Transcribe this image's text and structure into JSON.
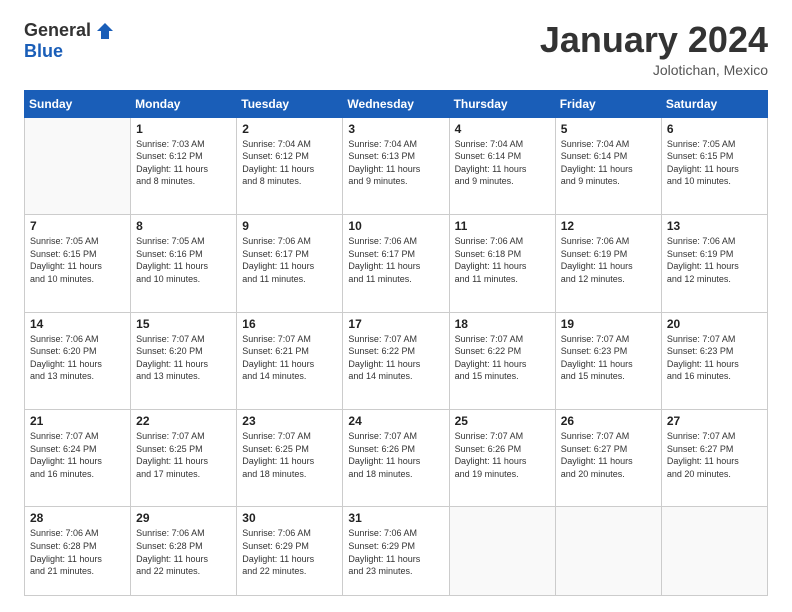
{
  "header": {
    "logo": {
      "general": "General",
      "blue": "Blue"
    },
    "title": "January 2024",
    "location": "Jolotichan, Mexico"
  },
  "calendar": {
    "days_of_week": [
      "Sunday",
      "Monday",
      "Tuesday",
      "Wednesday",
      "Thursday",
      "Friday",
      "Saturday"
    ],
    "weeks": [
      [
        {
          "day": "",
          "info": ""
        },
        {
          "day": "1",
          "info": "Sunrise: 7:03 AM\nSunset: 6:12 PM\nDaylight: 11 hours\nand 8 minutes."
        },
        {
          "day": "2",
          "info": "Sunrise: 7:04 AM\nSunset: 6:12 PM\nDaylight: 11 hours\nand 8 minutes."
        },
        {
          "day": "3",
          "info": "Sunrise: 7:04 AM\nSunset: 6:13 PM\nDaylight: 11 hours\nand 9 minutes."
        },
        {
          "day": "4",
          "info": "Sunrise: 7:04 AM\nSunset: 6:14 PM\nDaylight: 11 hours\nand 9 minutes."
        },
        {
          "day": "5",
          "info": "Sunrise: 7:04 AM\nSunset: 6:14 PM\nDaylight: 11 hours\nand 9 minutes."
        },
        {
          "day": "6",
          "info": "Sunrise: 7:05 AM\nSunset: 6:15 PM\nDaylight: 11 hours\nand 10 minutes."
        }
      ],
      [
        {
          "day": "7",
          "info": "Sunrise: 7:05 AM\nSunset: 6:15 PM\nDaylight: 11 hours\nand 10 minutes."
        },
        {
          "day": "8",
          "info": "Sunrise: 7:05 AM\nSunset: 6:16 PM\nDaylight: 11 hours\nand 10 minutes."
        },
        {
          "day": "9",
          "info": "Sunrise: 7:06 AM\nSunset: 6:17 PM\nDaylight: 11 hours\nand 11 minutes."
        },
        {
          "day": "10",
          "info": "Sunrise: 7:06 AM\nSunset: 6:17 PM\nDaylight: 11 hours\nand 11 minutes."
        },
        {
          "day": "11",
          "info": "Sunrise: 7:06 AM\nSunset: 6:18 PM\nDaylight: 11 hours\nand 11 minutes."
        },
        {
          "day": "12",
          "info": "Sunrise: 7:06 AM\nSunset: 6:19 PM\nDaylight: 11 hours\nand 12 minutes."
        },
        {
          "day": "13",
          "info": "Sunrise: 7:06 AM\nSunset: 6:19 PM\nDaylight: 11 hours\nand 12 minutes."
        }
      ],
      [
        {
          "day": "14",
          "info": "Sunrise: 7:06 AM\nSunset: 6:20 PM\nDaylight: 11 hours\nand 13 minutes."
        },
        {
          "day": "15",
          "info": "Sunrise: 7:07 AM\nSunset: 6:20 PM\nDaylight: 11 hours\nand 13 minutes."
        },
        {
          "day": "16",
          "info": "Sunrise: 7:07 AM\nSunset: 6:21 PM\nDaylight: 11 hours\nand 14 minutes."
        },
        {
          "day": "17",
          "info": "Sunrise: 7:07 AM\nSunset: 6:22 PM\nDaylight: 11 hours\nand 14 minutes."
        },
        {
          "day": "18",
          "info": "Sunrise: 7:07 AM\nSunset: 6:22 PM\nDaylight: 11 hours\nand 15 minutes."
        },
        {
          "day": "19",
          "info": "Sunrise: 7:07 AM\nSunset: 6:23 PM\nDaylight: 11 hours\nand 15 minutes."
        },
        {
          "day": "20",
          "info": "Sunrise: 7:07 AM\nSunset: 6:23 PM\nDaylight: 11 hours\nand 16 minutes."
        }
      ],
      [
        {
          "day": "21",
          "info": "Sunrise: 7:07 AM\nSunset: 6:24 PM\nDaylight: 11 hours\nand 16 minutes."
        },
        {
          "day": "22",
          "info": "Sunrise: 7:07 AM\nSunset: 6:25 PM\nDaylight: 11 hours\nand 17 minutes."
        },
        {
          "day": "23",
          "info": "Sunrise: 7:07 AM\nSunset: 6:25 PM\nDaylight: 11 hours\nand 18 minutes."
        },
        {
          "day": "24",
          "info": "Sunrise: 7:07 AM\nSunset: 6:26 PM\nDaylight: 11 hours\nand 18 minutes."
        },
        {
          "day": "25",
          "info": "Sunrise: 7:07 AM\nSunset: 6:26 PM\nDaylight: 11 hours\nand 19 minutes."
        },
        {
          "day": "26",
          "info": "Sunrise: 7:07 AM\nSunset: 6:27 PM\nDaylight: 11 hours\nand 20 minutes."
        },
        {
          "day": "27",
          "info": "Sunrise: 7:07 AM\nSunset: 6:27 PM\nDaylight: 11 hours\nand 20 minutes."
        }
      ],
      [
        {
          "day": "28",
          "info": "Sunrise: 7:06 AM\nSunset: 6:28 PM\nDaylight: 11 hours\nand 21 minutes."
        },
        {
          "day": "29",
          "info": "Sunrise: 7:06 AM\nSunset: 6:28 PM\nDaylight: 11 hours\nand 22 minutes."
        },
        {
          "day": "30",
          "info": "Sunrise: 7:06 AM\nSunset: 6:29 PM\nDaylight: 11 hours\nand 22 minutes."
        },
        {
          "day": "31",
          "info": "Sunrise: 7:06 AM\nSunset: 6:29 PM\nDaylight: 11 hours\nand 23 minutes."
        },
        {
          "day": "",
          "info": ""
        },
        {
          "day": "",
          "info": ""
        },
        {
          "day": "",
          "info": ""
        }
      ]
    ]
  }
}
